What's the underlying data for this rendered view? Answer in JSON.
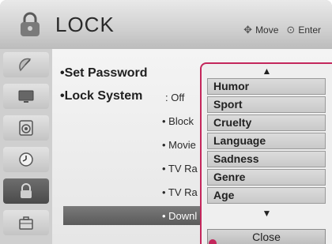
{
  "header": {
    "title": "LOCK",
    "icon": "lock-icon",
    "hint_move": "Move",
    "hint_enter": "Enter",
    "move_icon": "dpad-icon",
    "enter_icon": "ok-circle-icon"
  },
  "sidebar": {
    "tabs": [
      {
        "icon": "satellite-dish-icon"
      },
      {
        "icon": "tv-screen-icon"
      },
      {
        "icon": "speaker-icon"
      },
      {
        "icon": "clock-icon"
      },
      {
        "icon": "lock-icon",
        "active": true
      },
      {
        "icon": "suitcase-icon"
      }
    ]
  },
  "menu": {
    "set_password": "•Set Password",
    "lock_system": "•Lock System",
    "lock_system_value": ": Off",
    "rows": [
      "• Block",
      "• Movie",
      "• TV Ra",
      "• TV Ra",
      "• Downl"
    ]
  },
  "popup": {
    "up_arrow": "▲",
    "down_arrow": "▼",
    "items": [
      "Humor",
      "Sport",
      "Cruelty",
      "Language",
      "Sadness",
      "Genre",
      "Age"
    ],
    "close_label": "Close"
  },
  "colors": {
    "accent": "#c4275c",
    "highlight": "#5a5a5a"
  }
}
